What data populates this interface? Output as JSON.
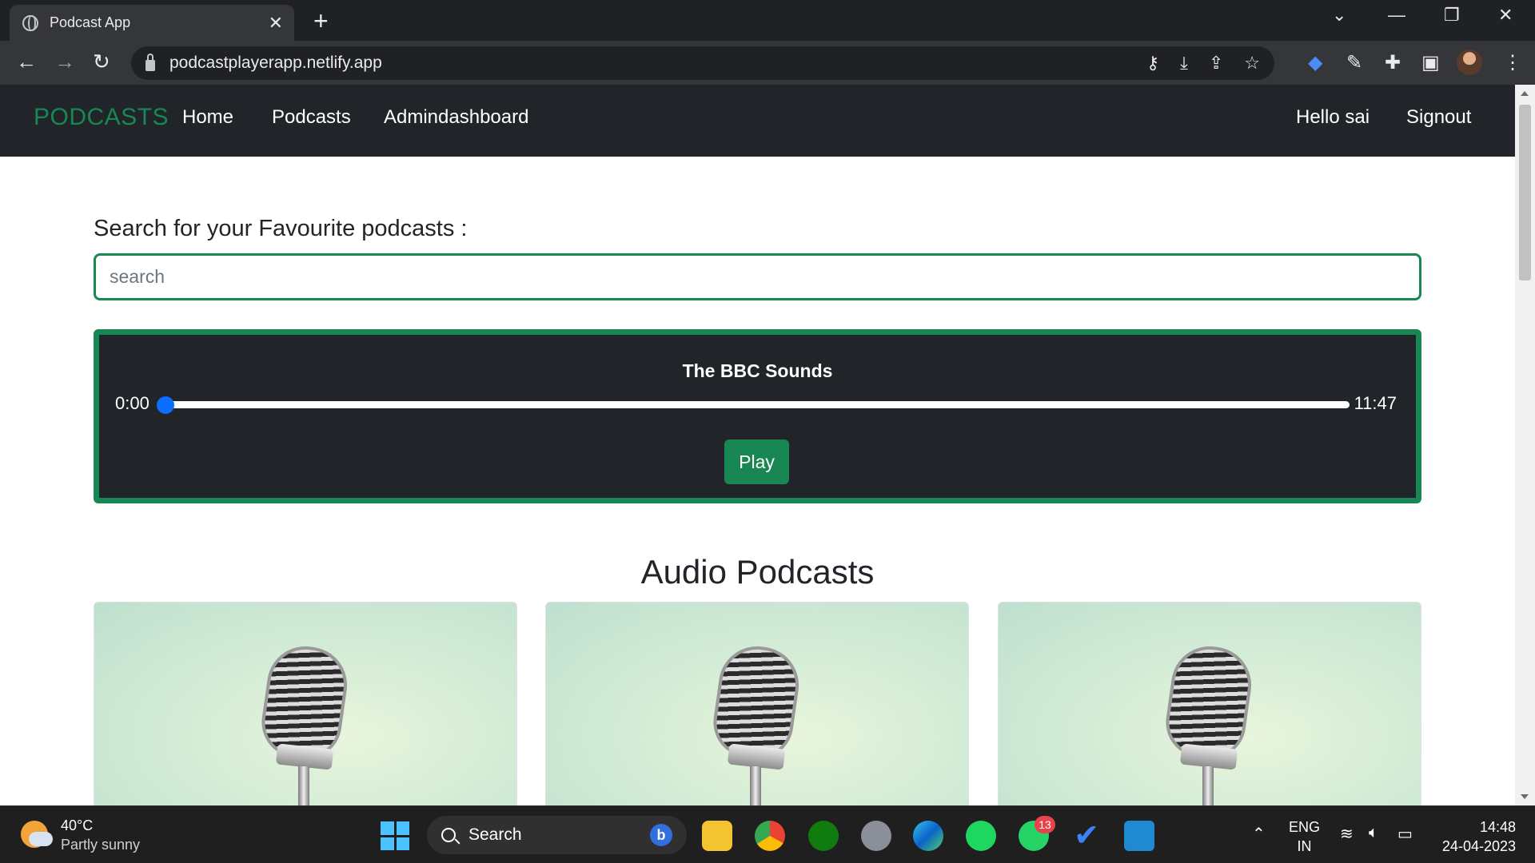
{
  "browser": {
    "tab_title": "Podcast App",
    "tab_close": "✕",
    "new_tab": "+",
    "url": "podcastplayerapp.netlify.app",
    "window_controls": [
      "⌄",
      "—",
      "❐",
      "✕"
    ]
  },
  "navbar": {
    "brand": "PODCASTS",
    "links": [
      "Home",
      "Podcasts",
      "Admindashboard"
    ],
    "greeting": "Hello sai",
    "signout": "Signout"
  },
  "search": {
    "label": "Search for your Favourite podcasts :",
    "placeholder": "search"
  },
  "player": {
    "title": "The BBC Sounds",
    "current_time": "0:00",
    "duration": "11:47",
    "progress": 0,
    "play_label": "Play"
  },
  "section": {
    "title": "Audio Podcasts"
  },
  "cards": [
    {
      "image": "microphone"
    },
    {
      "image": "microphone"
    },
    {
      "image": "microphone"
    }
  ],
  "taskbar": {
    "temperature": "40°C",
    "condition": "Partly sunny",
    "search_text": "Search",
    "whatsapp_badge": "13",
    "lang_line1": "ENG",
    "lang_line2": "IN",
    "time": "14:48",
    "date": "24-04-2023"
  },
  "colors": {
    "brand_green": "#198754",
    "dark_bg": "#212529",
    "slider_knob": "#0d6efd"
  }
}
